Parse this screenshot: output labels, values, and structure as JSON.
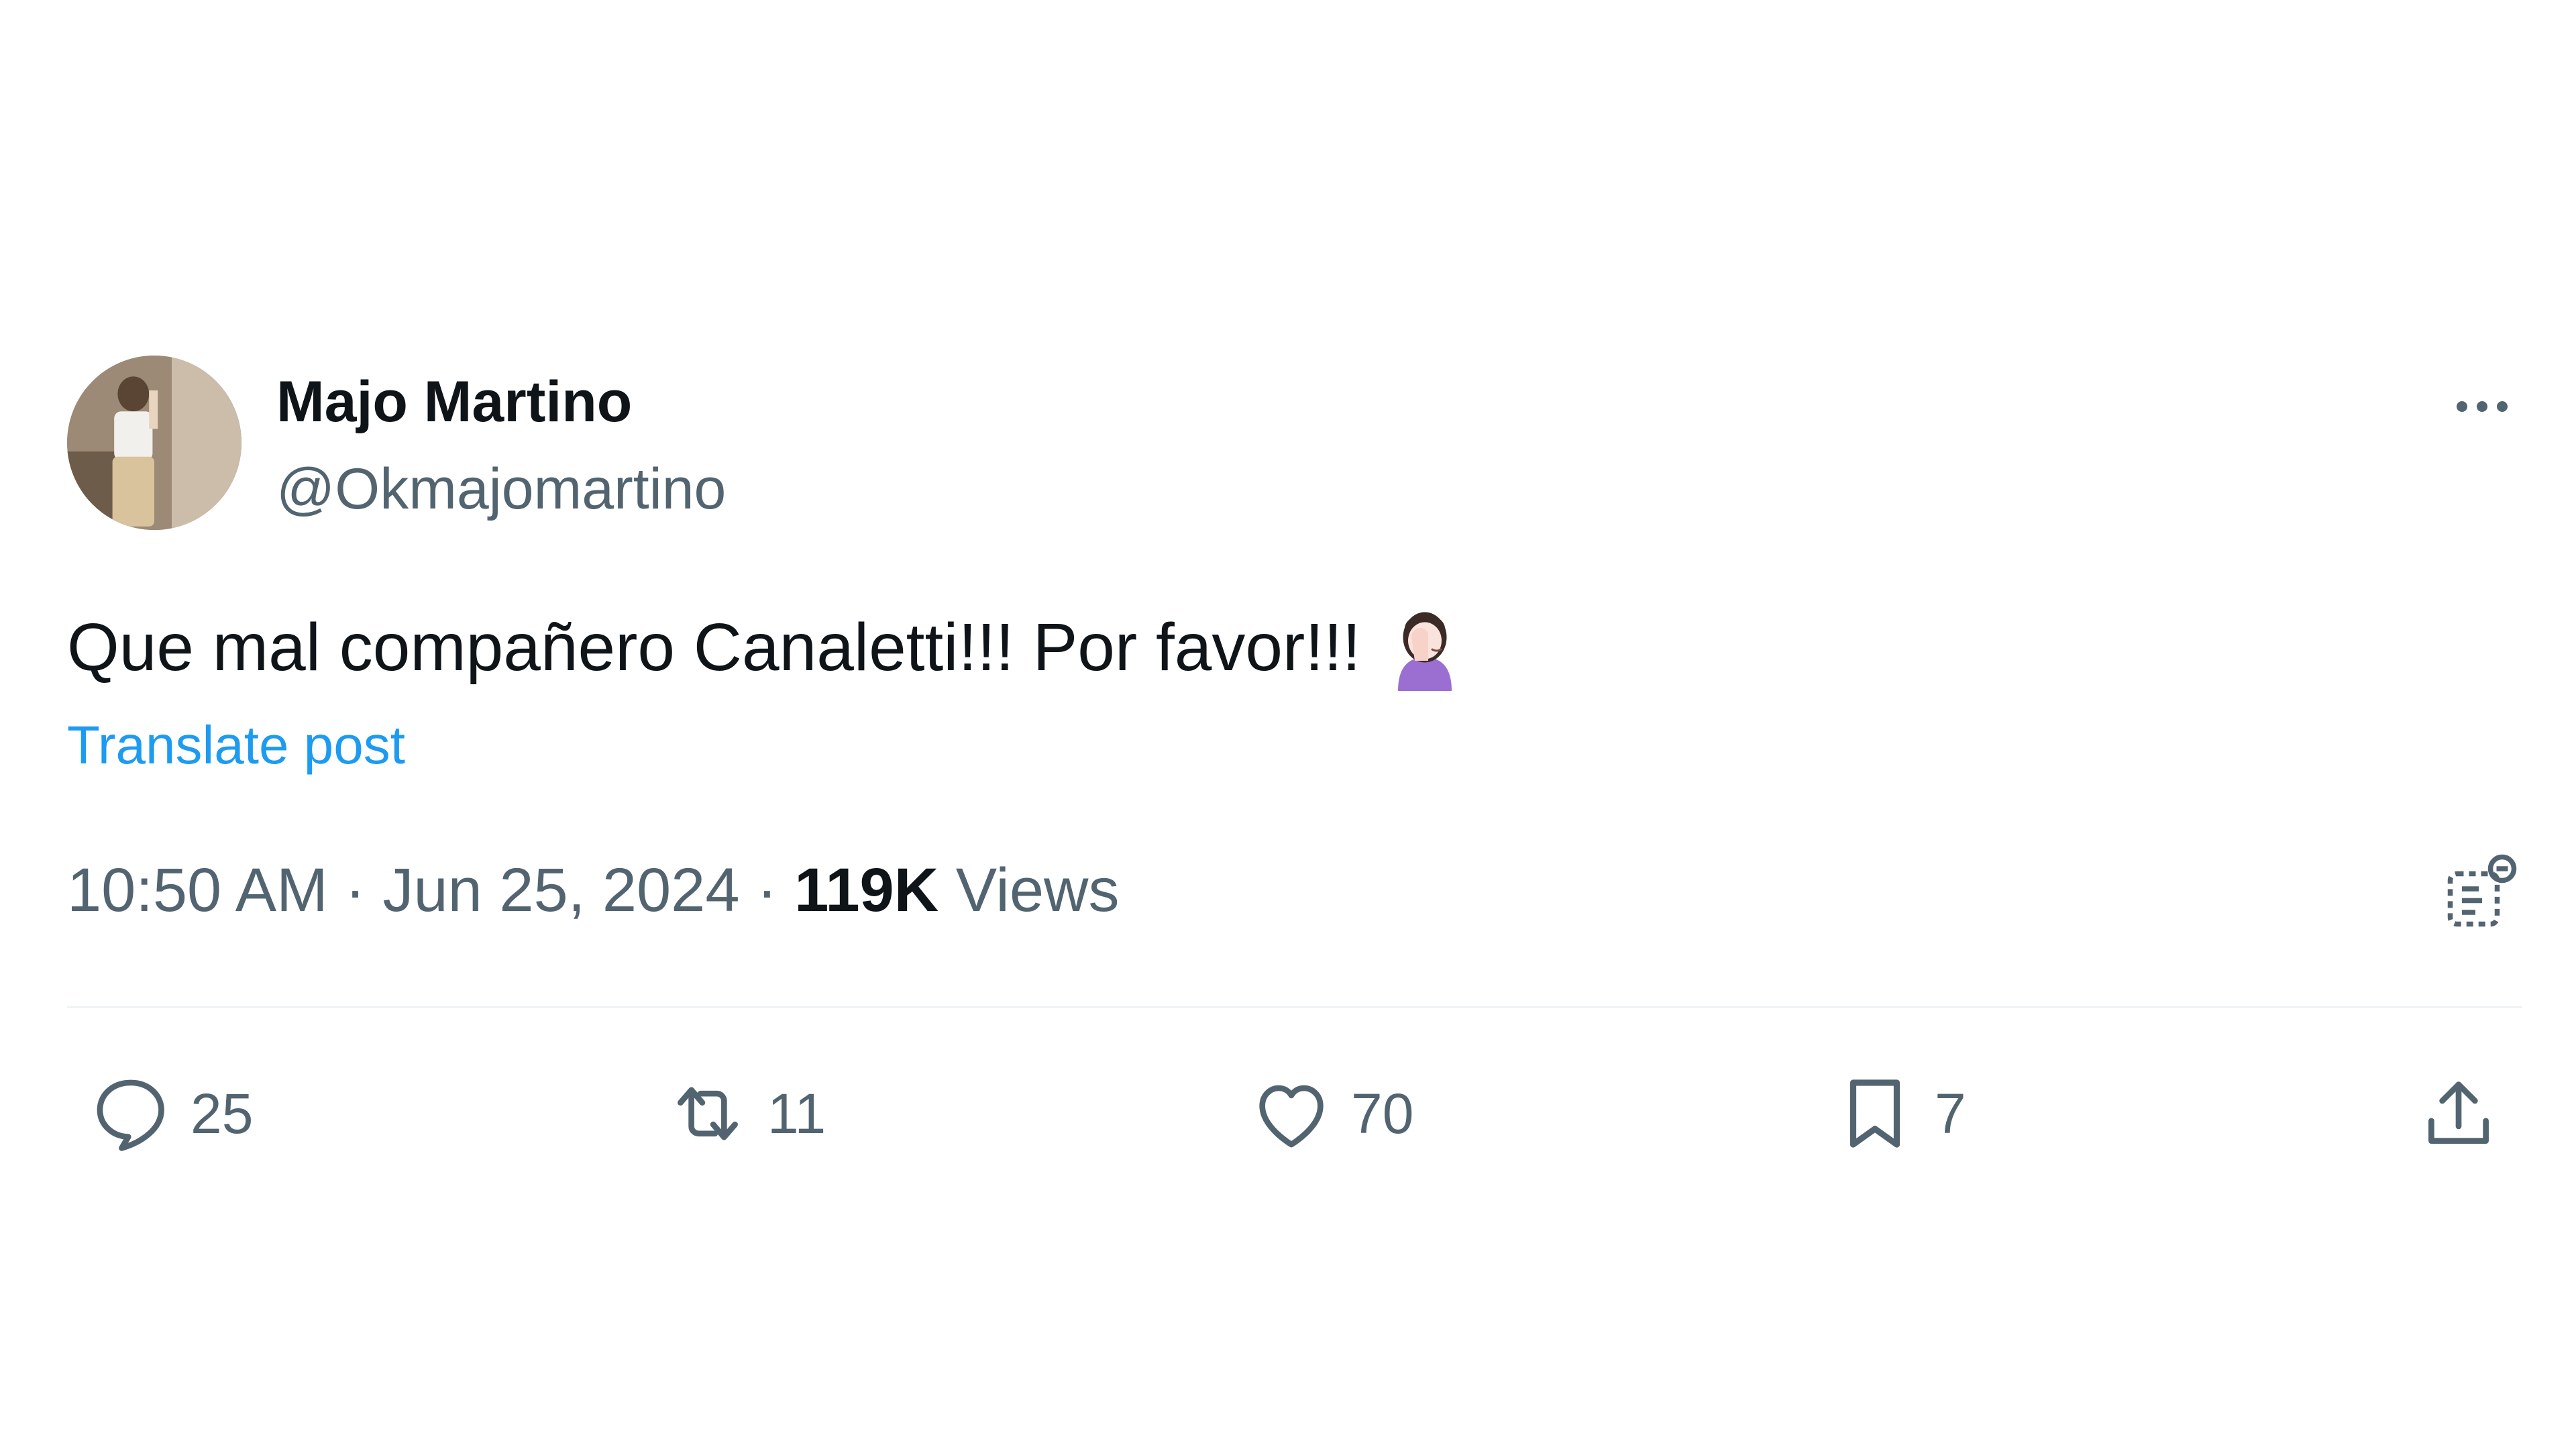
{
  "user": {
    "display_name": "Majo Martino",
    "handle": "@Okmajomartino"
  },
  "post": {
    "text": "Que mal compañero Canaletti!!! Por favor!!!",
    "emoji": "woman-facepalming-emoji",
    "translate_label": "Translate post",
    "time": "10:50 AM",
    "separator": "·",
    "date": "Jun 25, 2024",
    "views_count": "119K",
    "views_label": "Views"
  },
  "actions": {
    "replies": "25",
    "reposts": "11",
    "likes": "70",
    "bookmarks": "7"
  },
  "colors": {
    "text": "#0f1419",
    "secondary": "#536471",
    "link": "#1d9bf0",
    "divider": "#eff3f4"
  }
}
